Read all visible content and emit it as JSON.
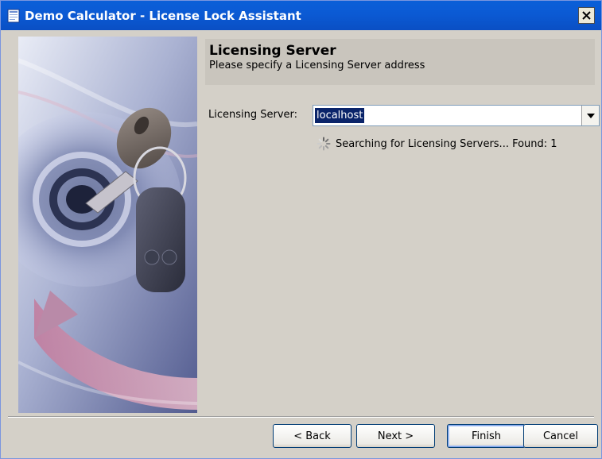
{
  "window": {
    "title": "Demo Calculator - License Lock Assistant"
  },
  "header": {
    "title": "Licensing Server",
    "subtitle": "Please specify a Licensing Server address"
  },
  "form": {
    "server_label": "Licensing Server:",
    "server_value": "localhost"
  },
  "status": {
    "text": "Searching for Licensing Servers... Found: 1"
  },
  "buttons": {
    "back": "< Back",
    "next": "Next >",
    "finish": "Finish",
    "cancel": "Cancel"
  },
  "icons": {
    "app": "document-icon",
    "close": "close-icon",
    "dropdown": "chevron-down-icon",
    "spinner": "spinner-icon",
    "side_image": "key-lock-illustration"
  },
  "colors": {
    "titlebar": "#0a5fd8",
    "selection": "#0a246a",
    "header_panel": "#c9c5bd",
    "dialog_bg": "#d4d0c8"
  }
}
